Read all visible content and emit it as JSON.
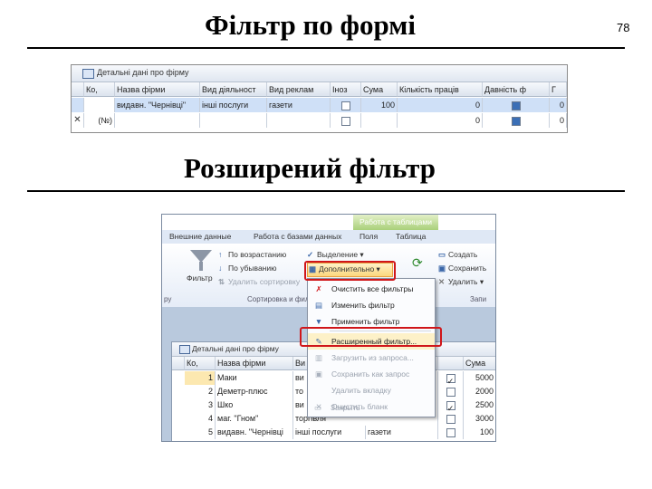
{
  "slide": {
    "title1": "Фільтр по формі",
    "title2": "Розширений фільтр",
    "page_number": "78"
  },
  "form_filter": {
    "window_title": "Детальні дані про фірму",
    "columns": [
      "Ко,",
      "Назва фірми",
      "Вид діяльност",
      "Вид реклам",
      "Іноз",
      "Сума",
      "Кількість праців",
      "Давність ф",
      "Г"
    ],
    "row": {
      "code": "",
      "name": "видавн. \"Чернівці\"",
      "activity": "інші послуги",
      "ad": "газети",
      "foreign": false,
      "sum": "100",
      "staff": "0",
      "age": true,
      "extra": "0"
    },
    "new_row": {
      "marker": "✕",
      "code": "(№)",
      "staff": "0",
      "age": "0"
    }
  },
  "ribbon": {
    "context_tab": "Работа с таблицами",
    "tabs": [
      "Внешние данные",
      "Работа с базами данных",
      "Поля",
      "Таблица"
    ],
    "sort": {
      "asc": "По возрастанию",
      "desc": "По убыванию",
      "remove": "Удалить сортировку",
      "filter": "Фильтр",
      "group": "Сортировка и фильтр"
    },
    "selection": "Выделение",
    "advanced": "Дополнительно",
    "create": "Создать",
    "save": "Сохранить",
    "delete": "Удалить",
    "left_group": "ру",
    "right_group": "Запи"
  },
  "menu": {
    "items": [
      {
        "label": "Очистить все фильтры",
        "disabled": false
      },
      {
        "label": "Изменить фильтр",
        "disabled": false
      },
      {
        "label": "Применить фильтр",
        "disabled": false
      },
      {
        "label": "Расширенный фильтр...",
        "disabled": false
      },
      {
        "label": "Загрузить из запроса...",
        "disabled": true
      },
      {
        "label": "Сохранить как запрос",
        "disabled": true
      },
      {
        "label": "Удалить вкладку",
        "disabled": true
      },
      {
        "label": "Очистить бланк",
        "disabled": true
      },
      {
        "label": "Закрыть",
        "disabled": true
      }
    ]
  },
  "table2": {
    "window_title": "Детальні дані про фірму",
    "columns": [
      "Ко,",
      "Назва фірми",
      "Ви",
      "Сума"
    ],
    "rows": [
      {
        "num": "1",
        "name": "Маки",
        "vi": "ви",
        "tail": "",
        "check": true,
        "sum": "5000"
      },
      {
        "num": "2",
        "name": "Деметр-плюс",
        "vi": "то",
        "tail": "",
        "check": false,
        "sum": "2000"
      },
      {
        "num": "3",
        "name": "Шко",
        "vi": "ви",
        "tail": "",
        "check": true,
        "sum": "2500"
      },
      {
        "num": "4",
        "name": "маг. \"Гном\"",
        "vi": "торгівля",
        "tail": "",
        "check": false,
        "sum": "3000"
      },
      {
        "num": "5",
        "name": "видавн. \"Чернівці",
        "vi": "інші послуги",
        "tail": "газети",
        "check": false,
        "sum": "100"
      }
    ]
  }
}
